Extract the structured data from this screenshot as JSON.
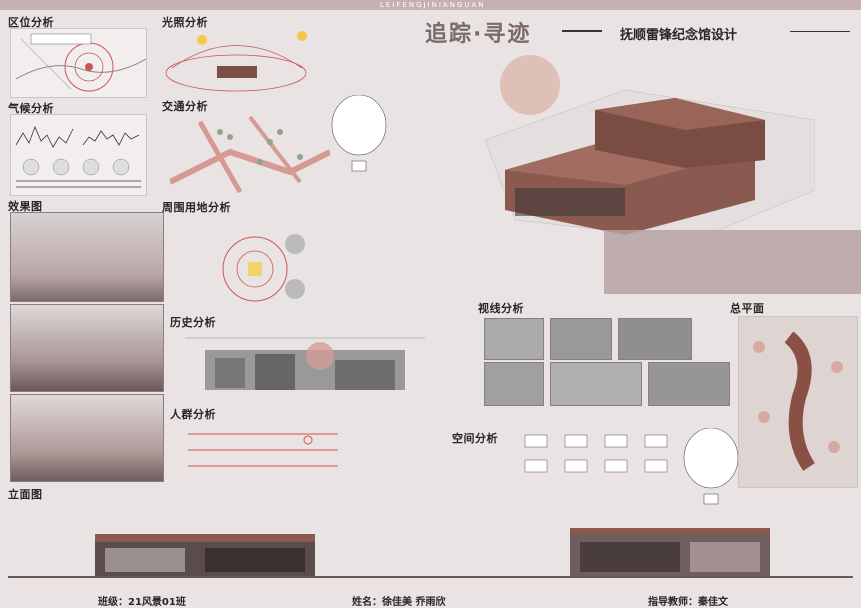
{
  "banner": {
    "text": "LEIFENGJINIANGUAN"
  },
  "header": {
    "main_title": "追踪·寻迹",
    "sub_title": "抚顺雷锋纪念馆设计"
  },
  "sections": {
    "location": "区位分析",
    "sunlight": "光照分析",
    "climate": "气候分析",
    "traffic": "交通分析",
    "effect": "效果图",
    "surrounding": "周围用地分析",
    "history": "历史分析",
    "crowd": "人群分析",
    "sightline": "视线分析",
    "site_plan": "总平面",
    "space": "空间分析",
    "elevation": "立面图"
  },
  "footer": {
    "class_label": "班级：21风景01班",
    "name_label": "姓名：徐佳美  乔雨欣",
    "teacher_label": "指导教师：秦佳文"
  },
  "colors": {
    "accent": "#8a4f45",
    "panel": "#f3eeee",
    "banner": "#c7b0b0",
    "background": "#e9e3e3"
  }
}
